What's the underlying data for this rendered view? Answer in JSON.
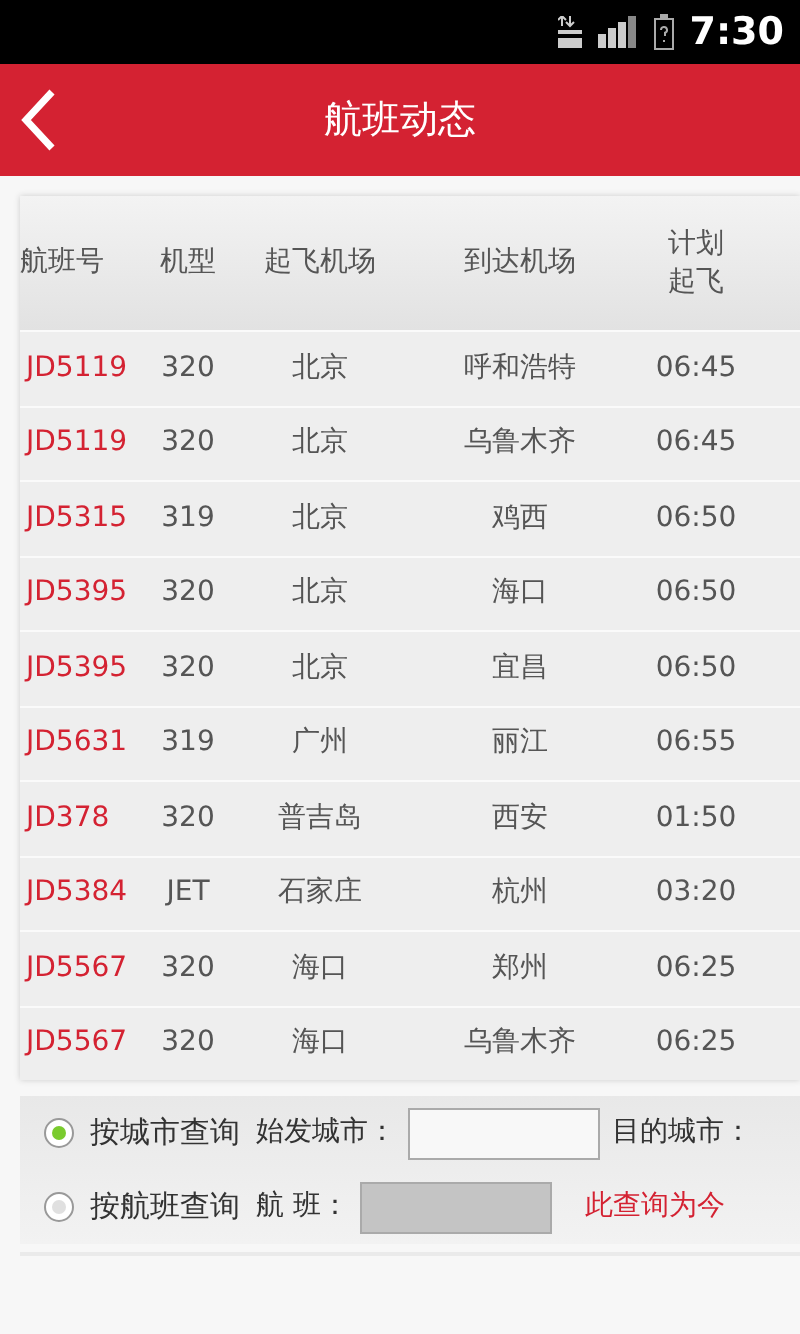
{
  "status_bar": {
    "time": "7:30"
  },
  "header": {
    "title": "航班动态"
  },
  "table": {
    "columns": [
      "航班号",
      "机型",
      "起飞机场",
      "到达机场",
      "计划起飞"
    ],
    "rows": [
      {
        "flight": "JD5119",
        "type": "320",
        "from": "北京",
        "to": "呼和浩特",
        "planned": "06:45"
      },
      {
        "flight": "JD5119",
        "type": "320",
        "from": "北京",
        "to": "乌鲁木齐",
        "planned": "06:45"
      },
      {
        "flight": "JD5315",
        "type": "319",
        "from": "北京",
        "to": "鸡西",
        "planned": "06:50"
      },
      {
        "flight": "JD5395",
        "type": "320",
        "from": "北京",
        "to": "海口",
        "planned": "06:50"
      },
      {
        "flight": "JD5395",
        "type": "320",
        "from": "北京",
        "to": "宜昌",
        "planned": "06:50"
      },
      {
        "flight": "JD5631",
        "type": "319",
        "from": "广州",
        "to": "丽江",
        "planned": "06:55"
      },
      {
        "flight": "JD378",
        "type": "320",
        "from": "普吉岛",
        "to": "西安",
        "planned": "01:50"
      },
      {
        "flight": "JD5384",
        "type": "JET",
        "from": "石家庄",
        "to": "杭州",
        "planned": "03:20"
      },
      {
        "flight": "JD5567",
        "type": "320",
        "from": "海口",
        "to": "郑州",
        "planned": "06:25"
      },
      {
        "flight": "JD5567",
        "type": "320",
        "from": "海口",
        "to": "乌鲁木齐",
        "planned": "06:25"
      }
    ]
  },
  "query": {
    "rows": [
      {
        "option": {
          "label": "按城市查询",
          "selected": true
        },
        "items": [
          {
            "kind": "field",
            "label": "始发城市：",
            "disabled": false
          },
          {
            "kind": "label",
            "label": "目的城市："
          }
        ]
      },
      {
        "option": {
          "label": "按航班查询",
          "selected": false
        },
        "items": [
          {
            "kind": "field",
            "label": "航 班：",
            "disabled": true
          },
          {
            "kind": "notice",
            "label": "此查询为今"
          }
        ]
      }
    ]
  }
}
